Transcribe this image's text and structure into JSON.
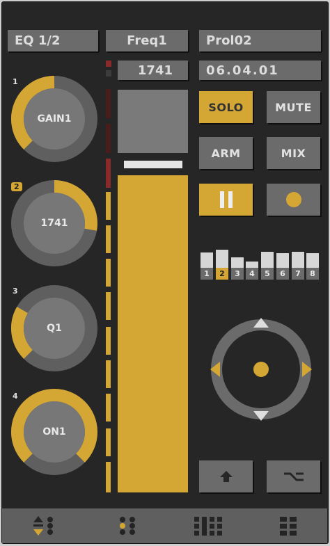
{
  "header": {
    "page_label": "EQ 1/2",
    "param_label": "Freq1",
    "preset_label": "Prol02"
  },
  "readouts": {
    "value": "1741",
    "date": "06.04.01"
  },
  "knobs": [
    {
      "index": "1",
      "label": "GAIN1",
      "selected": false,
      "arc_start_deg": 225,
      "arc_end_deg": 360,
      "color": "#d4a633"
    },
    {
      "index": "2",
      "label": "1741",
      "selected": true,
      "arc_start_deg": 0,
      "arc_end_deg": 100,
      "color": "#d4a633"
    },
    {
      "index": "3",
      "label": "Q1",
      "selected": false,
      "arc_start_deg": 225,
      "arc_end_deg": 300,
      "color": "#d4a633"
    },
    {
      "index": "4",
      "label": "ON1",
      "selected": false,
      "arc_start_deg": 225,
      "arc_end_deg": 495,
      "color": "#d4a633"
    }
  ],
  "meter": {
    "level": 1.0,
    "color": "#d4a633"
  },
  "buttons": {
    "solo": "SOLO",
    "mute": "MUTE",
    "arm": "ARM",
    "mix": "MIX"
  },
  "banks": {
    "labels": [
      "1",
      "2",
      "3",
      "4",
      "5",
      "6",
      "7",
      "8"
    ],
    "selected": "2"
  },
  "colors": {
    "accent": "#d4a633",
    "panel": "#262626",
    "control": "#6b6b6b",
    "meter_red": "#8a2a2a"
  },
  "icons": {
    "play_pause": "pause-icon",
    "record": "record-icon",
    "shift": "shift-arrow-up-icon",
    "alt": "option-key-icon",
    "dpad": "dpad-icon",
    "bottom": [
      "bank-arrows-icon",
      "grid-2x3-icon",
      "mixer-grid-icon",
      "pads-grid-icon"
    ]
  }
}
